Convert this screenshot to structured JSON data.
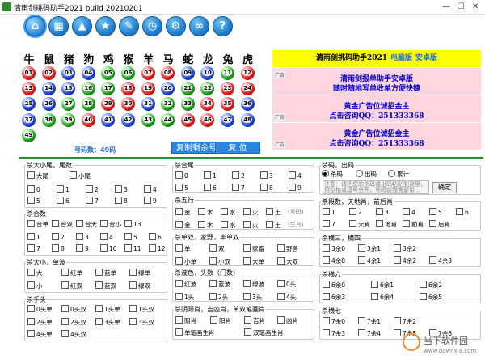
{
  "window": {
    "title": "清雨剑挑码助手2021 build 20210201",
    "minimize": "—",
    "maximize": "☐",
    "close": "✕"
  },
  "toolbar": [
    {
      "icon": "home-icon",
      "glyph": "⌂"
    },
    {
      "icon": "calculator-icon",
      "glyph": "▦"
    },
    {
      "icon": "navigation-icon",
      "glyph": "▲"
    },
    {
      "icon": "star-icon",
      "glyph": "★"
    },
    {
      "icon": "edit-icon",
      "glyph": "✎"
    },
    {
      "icon": "clock-icon",
      "glyph": "◷"
    },
    {
      "icon": "gear-icon",
      "glyph": "⚙"
    },
    {
      "icon": "link-icon",
      "glyph": "∞"
    },
    {
      "icon": "help-icon",
      "glyph": "?"
    }
  ],
  "zodiac": [
    "牛",
    "鼠",
    "猪",
    "狗",
    "鸡",
    "猴",
    "羊",
    "马",
    "蛇",
    "龙",
    "兔",
    "虎"
  ],
  "balls": [
    {
      "n": "01",
      "c": "red"
    },
    {
      "n": "02",
      "c": "red"
    },
    {
      "n": "03",
      "c": "blue"
    },
    {
      "n": "04",
      "c": "blue"
    },
    {
      "n": "05",
      "c": "green"
    },
    {
      "n": "06",
      "c": "green"
    },
    {
      "n": "07",
      "c": "red"
    },
    {
      "n": "08",
      "c": "red"
    },
    {
      "n": "09",
      "c": "blue"
    },
    {
      "n": "10",
      "c": "blue"
    },
    {
      "n": "11",
      "c": "green"
    },
    {
      "n": "12",
      "c": "red"
    },
    {
      "n": "13",
      "c": "red"
    },
    {
      "n": "14",
      "c": "blue"
    },
    {
      "n": "15",
      "c": "blue"
    },
    {
      "n": "16",
      "c": "green"
    },
    {
      "n": "17",
      "c": "green"
    },
    {
      "n": "18",
      "c": "red"
    },
    {
      "n": "19",
      "c": "red"
    },
    {
      "n": "20",
      "c": "blue"
    },
    {
      "n": "21",
      "c": "green"
    },
    {
      "n": "22",
      "c": "green"
    },
    {
      "n": "23",
      "c": "red"
    },
    {
      "n": "24",
      "c": "red"
    },
    {
      "n": "25",
      "c": "blue"
    },
    {
      "n": "26",
      "c": "blue"
    },
    {
      "n": "27",
      "c": "green"
    },
    {
      "n": "28",
      "c": "green"
    },
    {
      "n": "29",
      "c": "red"
    },
    {
      "n": "30",
      "c": "red"
    },
    {
      "n": "31",
      "c": "blue"
    },
    {
      "n": "32",
      "c": "green"
    },
    {
      "n": "33",
      "c": "green"
    },
    {
      "n": "34",
      "c": "red"
    },
    {
      "n": "35",
      "c": "red"
    },
    {
      "n": "36",
      "c": "blue"
    },
    {
      "n": "37",
      "c": "blue"
    },
    {
      "n": "38",
      "c": "green"
    },
    {
      "n": "39",
      "c": "green"
    },
    {
      "n": "40",
      "c": "red"
    },
    {
      "n": "41",
      "c": "blue"
    },
    {
      "n": "42",
      "c": "blue"
    },
    {
      "n": "43",
      "c": "green"
    },
    {
      "n": "44",
      "c": "green"
    },
    {
      "n": "45",
      "c": "red"
    },
    {
      "n": "46",
      "c": "red"
    },
    {
      "n": "47",
      "c": "blue"
    },
    {
      "n": "48",
      "c": "blue"
    },
    {
      "n": "49",
      "c": "green"
    }
  ],
  "count_label": "号码数：49码",
  "buttons": {
    "copy": "复制剩余号码",
    "reset": "复 位",
    "confirm": "确定"
  },
  "ads": {
    "head_title": "清雨剑挑码助手2021",
    "head_pc": "电脑版",
    "head_mobile": "安卓版",
    "tag": "广告",
    "ad1": [
      "清雨剑报单助手安卓版",
      "随时随地写单收单方便快捷"
    ],
    "ad2": [
      "黄金广告位诚招金主",
      "点击咨询QQ：251333368"
    ],
    "ad3": [
      "黄金广告位诚招金主",
      "点击咨询QQ：251333368"
    ]
  },
  "panels": {
    "p1": {
      "title": "杀大小尾，尾数",
      "r1": [
        "大尾",
        "小尾"
      ],
      "r2": [
        "0",
        "1",
        "2",
        "3",
        "4"
      ],
      "r3": [
        "5",
        "6",
        "7",
        "8",
        "9"
      ]
    },
    "p2": {
      "title": "杀合数",
      "r1": [
        "合单",
        "合双",
        "合大",
        "合小",
        "13"
      ],
      "r2": [
        "1",
        "2",
        "3",
        "4",
        "5",
        "6"
      ],
      "r3": [
        "7",
        "8",
        "9",
        "10",
        "11",
        "12"
      ]
    },
    "p3": {
      "title": "杀大小，单波",
      "r1": [
        "大",
        "红单",
        "蓝单",
        "绿单"
      ],
      "r2": [
        "小",
        "红双",
        "蓝双",
        "绿双"
      ]
    },
    "p4": {
      "title": "杀手头",
      "r1": [
        "0头单",
        "0头双",
        "1头单",
        "1头双"
      ],
      "r2": [
        "2头单",
        "2头双",
        "3头单",
        "3头双"
      ],
      "r3": [
        "4头单",
        "4头双"
      ]
    },
    "p5": {
      "title": "杀合尾",
      "r1": [
        "0",
        "1",
        "2",
        "3",
        "4"
      ],
      "r2": [
        "5",
        "6",
        "7",
        "8",
        "9"
      ]
    },
    "p6": {
      "title": "杀五行",
      "r1": [
        "金",
        "木",
        "水",
        "火",
        "土"
      ],
      "r2": [
        "金",
        "木",
        "水",
        "火",
        "土"
      ],
      "note1": "(号码)",
      "note2": "(生肖)"
    },
    "p7": {
      "title": "杀单双，家野，半单双",
      "r1": [
        "单",
        "双",
        "家畜",
        "野兽"
      ],
      "r2": [
        "小单",
        "小双",
        "大单",
        "大双"
      ]
    },
    "p8": {
      "title": "杀波色，头数（门数）",
      "r1": [
        "红波",
        "蓝波",
        "绿波",
        "0头"
      ],
      "r2": [
        "1头",
        "2头",
        "3头",
        "4头"
      ]
    },
    "p9": {
      "title": "杀阴阳肖，吉凶肖，单双笔画肖",
      "r1": [
        "阴肖",
        "阳肖",
        "吉肖",
        "凶肖"
      ],
      "r2": [
        "单笔画生肖",
        "双笔画生肖"
      ]
    },
    "p10": {
      "title": "杀码，出码",
      "r1": [
        "杀码",
        "出码",
        "累计"
      ],
      "placeholder": "注意：请把您的杀码或出码粘贴到这里，用空格或逗号分开，号码前面需要带 .. 如：01,02 ..."
    },
    "p11": {
      "title": "杀段数，天地肖，前后肖",
      "r1": [
        "1",
        "2",
        "3",
        "4",
        "5",
        "6"
      ],
      "r2": [
        "7",
        "天肖",
        "地肖",
        "前肖",
        "后肖"
      ]
    },
    "p12": {
      "title": "杀横三，横四",
      "r1": [
        "3余0",
        "3余1",
        "3余2"
      ],
      "r2": [
        "4余0",
        "4余1",
        "4余2",
        "4余3"
      ]
    },
    "p13": {
      "title": "杀横六",
      "r1": [
        "6余0",
        "6余1",
        "6余2"
      ],
      "r2": [
        "6余3",
        "6余4",
        "6余5"
      ]
    },
    "p14": {
      "title": "杀横七",
      "r1": [
        "7余0",
        "7余1",
        "7余2"
      ],
      "r2": [
        "7余3",
        "7余4",
        "7余5",
        "7余6"
      ]
    }
  },
  "watermark": {
    "line1": "当下软件园",
    "line2": "www.downxia.com"
  }
}
